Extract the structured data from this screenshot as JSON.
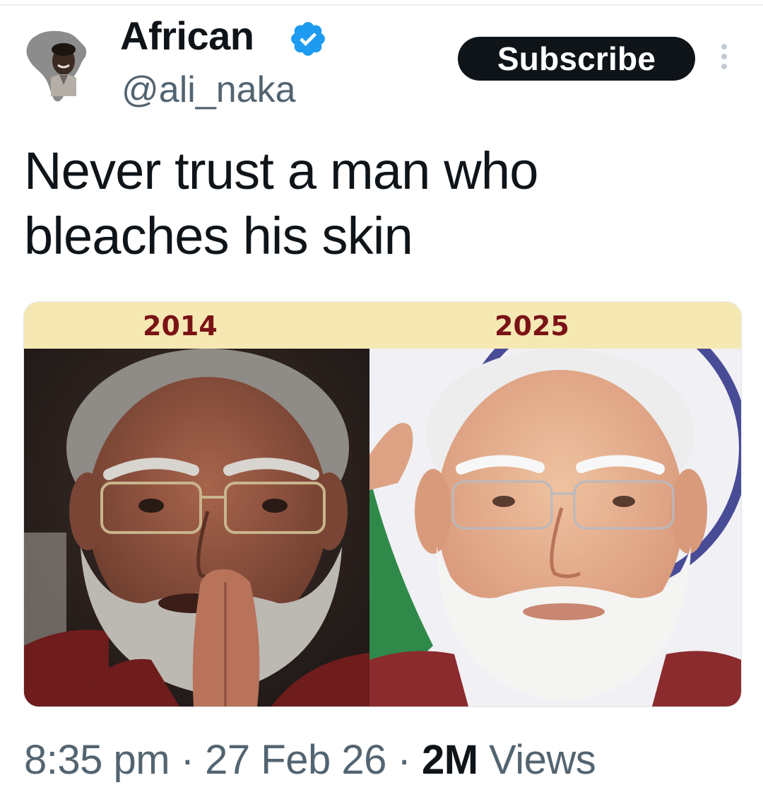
{
  "author": {
    "display_name": "African",
    "handle": "@ali_naka",
    "verified_icon": "verified-badge-icon",
    "avatar_icon": "africa-map-portrait-avatar"
  },
  "header": {
    "subscribe_label": "Subscribe",
    "more_icon": "more-vertical-icon"
  },
  "tweet": {
    "text_line1": "Never trust a man who",
    "text_line2": "bleaches his skin"
  },
  "media": {
    "left_label": "2014",
    "right_label": "2025",
    "label_color": "#7a1316",
    "band_color": "#f6e8b3"
  },
  "footer": {
    "time": "8:35 pm",
    "date": "27 Feb 26",
    "views_count": "2M",
    "views_label": "Views",
    "separator": "·"
  },
  "colors": {
    "text_primary": "#0f1419",
    "text_secondary": "#536471",
    "verified_blue": "#1d9bf0"
  }
}
